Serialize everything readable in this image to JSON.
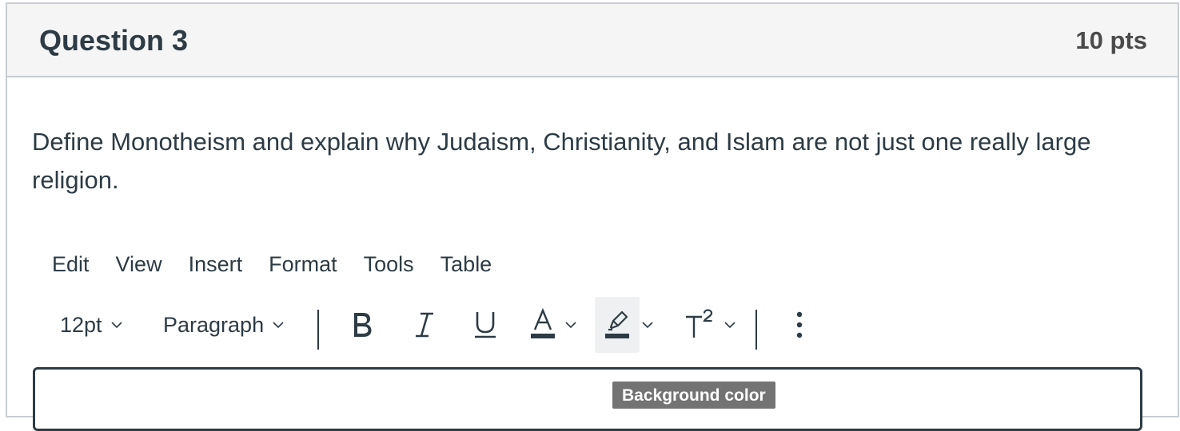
{
  "question": {
    "title": "Question 3",
    "points": "10 pts",
    "text": "Define Monotheism and explain why Judaism, Christianity, and Islam are not just one really large religion."
  },
  "editor": {
    "menubar": [
      {
        "label": "Edit"
      },
      {
        "label": "View"
      },
      {
        "label": "Insert"
      },
      {
        "label": "Format"
      },
      {
        "label": "Tools"
      },
      {
        "label": "Table"
      }
    ],
    "toolbar": {
      "font_size": "12pt",
      "block_format": "Paragraph",
      "bold_icon": "bold-icon",
      "italic_icon": "italic-icon",
      "underline_icon": "underline-icon",
      "text_color_icon": "text-color-icon",
      "background_color_icon": "highlighter-icon",
      "superscript_icon": "superscript-icon",
      "more_icon": "more-vertical-icon"
    },
    "tooltip": "Background color"
  },
  "colors": {
    "text": "#2d3b45",
    "header_bg": "#f5f5f5",
    "border": "#c7cdd1",
    "tooltip_bg": "#737373",
    "active_button_bg": "#eef0f1"
  }
}
